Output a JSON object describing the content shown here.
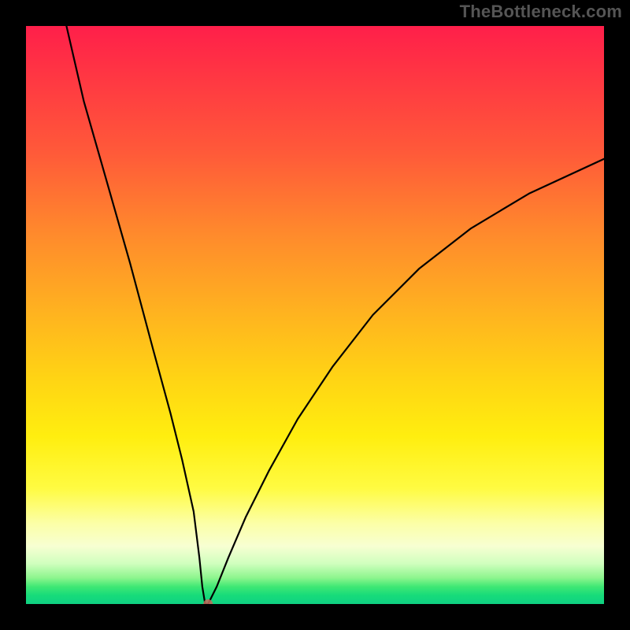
{
  "watermark": "TheBottleneck.com",
  "chart_data": {
    "type": "line",
    "title": "",
    "xlabel": "",
    "ylabel": "",
    "xlim": [
      0,
      100
    ],
    "ylim": [
      0,
      100
    ],
    "series": [
      {
        "name": "bottleneck-curve",
        "x": [
          7,
          10,
          14,
          18,
          22,
          25,
          27,
          29,
          30,
          30.5,
          31,
          31.5,
          33,
          35,
          38,
          42,
          47,
          53,
          60,
          68,
          77,
          87,
          100
        ],
        "values": [
          100,
          87,
          73,
          59,
          44,
          33,
          25,
          16,
          8,
          3,
          0,
          0,
          3,
          8,
          15,
          23,
          32,
          41,
          50,
          58,
          65,
          71,
          77
        ]
      }
    ],
    "marker": {
      "x": 31.5,
      "y": 0,
      "label": "optimal-point"
    },
    "gradient_stops": [
      {
        "pos": 0.0,
        "color": "#ff1f4a"
      },
      {
        "pos": 0.5,
        "color": "#ffb41f"
      },
      {
        "pos": 0.8,
        "color": "#fffb42"
      },
      {
        "pos": 0.93,
        "color": "#d0ffbe"
      },
      {
        "pos": 1.0,
        "color": "#0fd182"
      }
    ]
  }
}
